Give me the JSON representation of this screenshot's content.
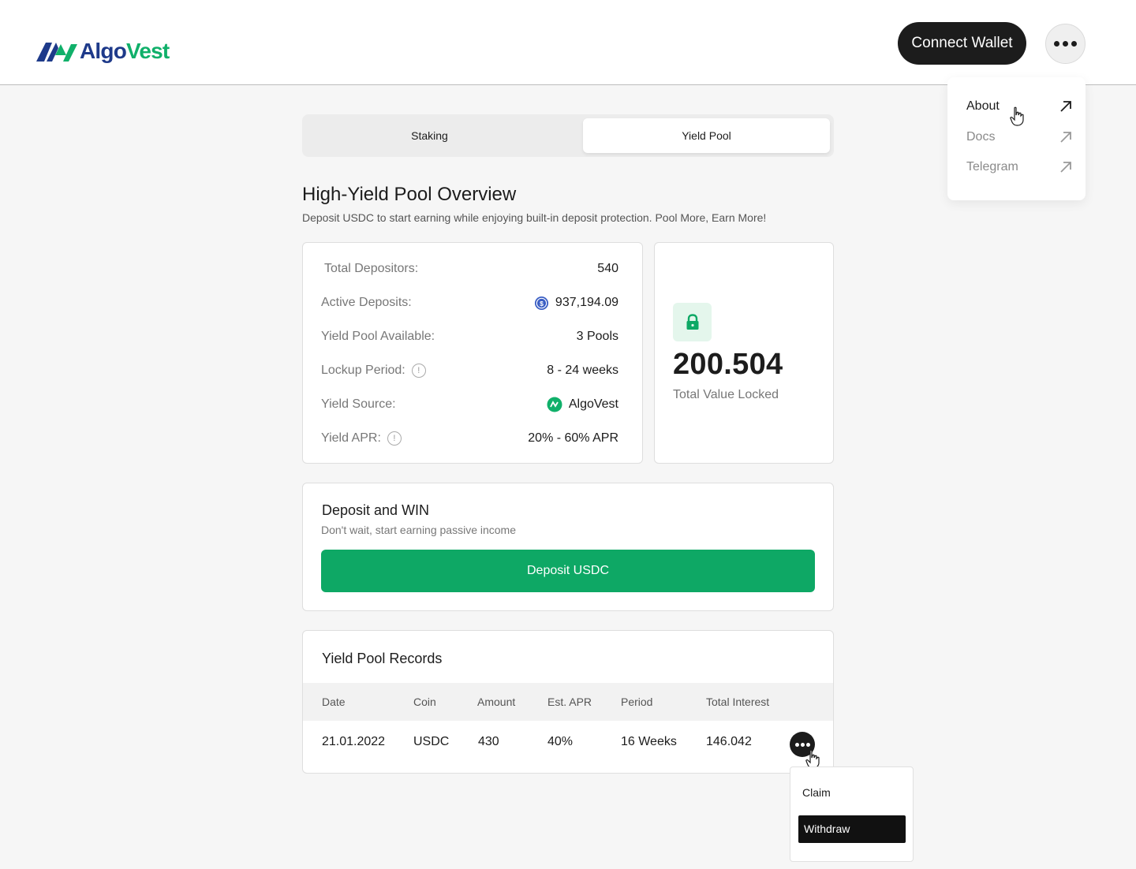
{
  "header": {
    "logo_text_a": "Algo",
    "logo_text_b": "Vest",
    "connect_label": "Connect Wallet"
  },
  "menu": {
    "items": [
      {
        "label": "About"
      },
      {
        "label": "Docs"
      },
      {
        "label": "Telegram"
      }
    ]
  },
  "tabs": [
    {
      "label": "Staking"
    },
    {
      "label": "Yield Pool"
    }
  ],
  "overview": {
    "title": "High-Yield Pool Overview",
    "subtitle": "Deposit USDC to start earning while enjoying built-in deposit protection. Pool More, Earn More!"
  },
  "stats": [
    {
      "label": "Total Depositors:",
      "value": "540"
    },
    {
      "label": "Active Deposits:",
      "value": "937,194.09"
    },
    {
      "label": "Yield Pool Available:",
      "value": "3 Pools"
    },
    {
      "label": "Lockup Period:",
      "value": "8 - 24 weeks"
    },
    {
      "label": "Yield Source:",
      "value": "AlgoVest"
    },
    {
      "label": "Yield APR:",
      "value": "20% - 60% APR"
    }
  ],
  "tvl": {
    "value": "200.504",
    "label": "Total Value Locked"
  },
  "deposit": {
    "title": "Deposit and WIN",
    "subtitle": "Don't wait, start earning passive income",
    "button": "Deposit USDC"
  },
  "records": {
    "title": "Yield Pool Records",
    "columns": [
      "Date",
      "Coin",
      "Amount",
      "Est. APR",
      "Period",
      "Total Interest"
    ],
    "rows": [
      {
        "date": "21.01.2022",
        "coin": "USDC",
        "amount": "430",
        "apr": "40%",
        "period": "16 Weeks",
        "interest": "146.042"
      }
    ]
  },
  "row_menu": {
    "claim": "Claim",
    "withdraw": "Withdraw"
  },
  "colors": {
    "brand_dark": "#1e3a8a",
    "brand_green": "#10b06a",
    "accent_button": "#0ea865"
  }
}
